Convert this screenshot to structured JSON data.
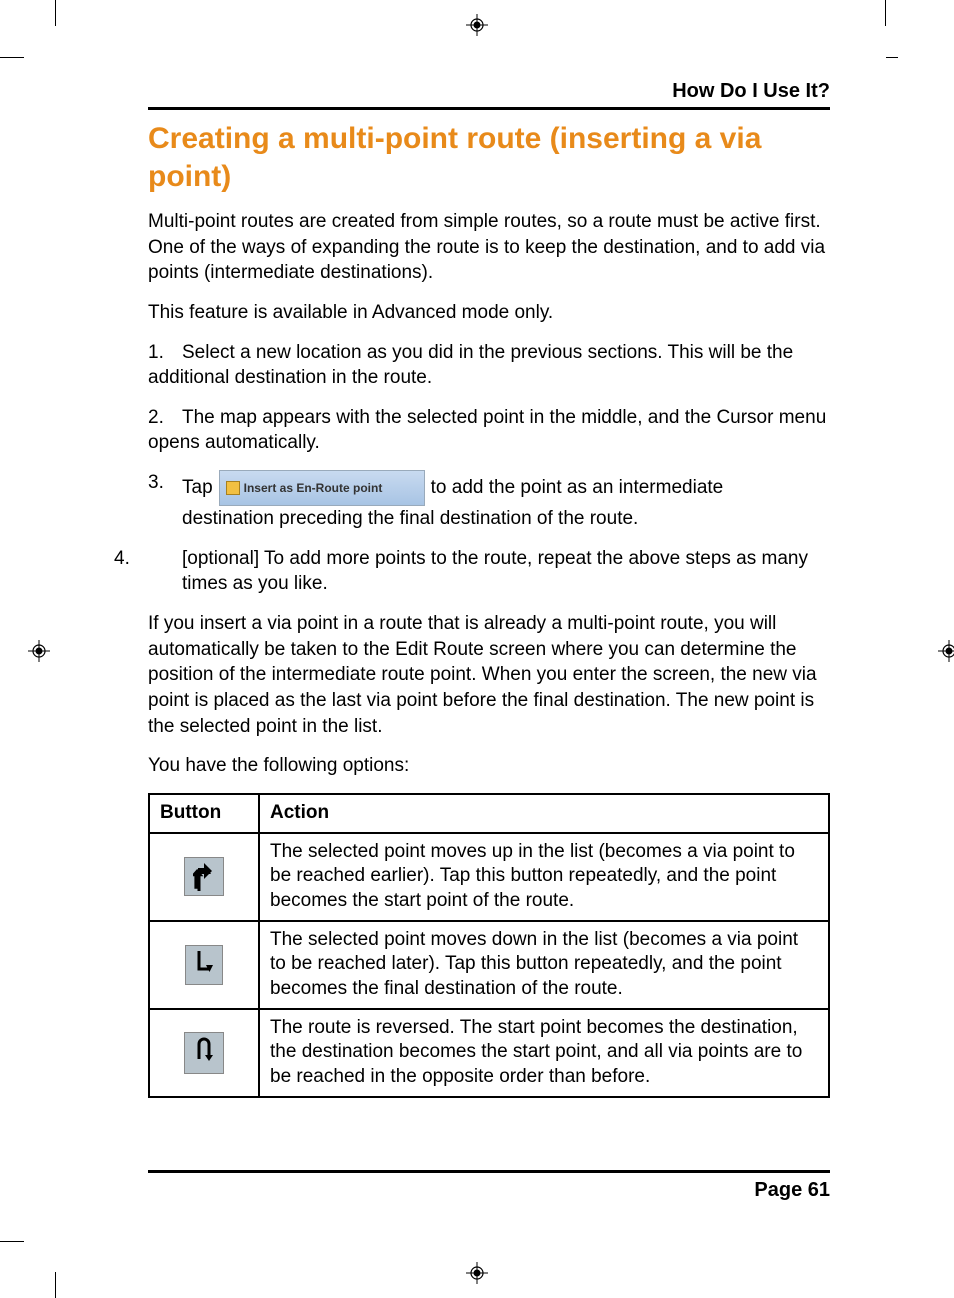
{
  "header": {
    "section": "How Do I Use It?"
  },
  "title": "Creating a multi-point route (inserting a via point)",
  "p_intro": "Multi-point routes are created from simple routes, so a route must be active first. One of the ways of expanding the route is to keep the destination, and to add via points (intermediate destinations).",
  "p_mode": "This feature is available in Advanced mode only.",
  "step1_num": "1.",
  "step1": "Select a new location as you did in the previous sections. This will be the additional destination in the route.",
  "step2_num": "2.",
  "step2": "The map appears with the selected point in the middle, and the Cursor menu opens automatically.",
  "step3_num": "3.",
  "step3_a": "Tap",
  "step3_btn": "Insert as En-Route point",
  "step3_b": "to add the point as an intermediate",
  "step3_c": "destination preceding the final destination of the route.",
  "step4_num": "4.",
  "step4": "[optional] To add more points to the route, repeat the above steps as many times as you like.",
  "p_explain": "If you insert a via point in a route that is already a multi-point route, you will automatically be taken to the Edit Route screen where you can determine the position of the intermediate route point. When you enter the screen, the new via point is placed as the last via point before the final destination. The new point is the selected point in the list.",
  "p_options": "You have the following options:",
  "table": {
    "h1": "Button",
    "h2": "Action",
    "r1": "The selected point moves up in the list (becomes a via point to be reached earlier). Tap this button repeatedly, and the point becomes the start point of the route.",
    "r2": "The selected point moves down in the list (becomes a via point to be reached later). Tap this button repeatedly, and the point becomes the final destination of the route.",
    "r3": "The route is reversed. The start point becomes the destination, the destination becomes the start point, and all via points are to be reached in the opposite order than before."
  },
  "footer": {
    "page": "Page 61"
  }
}
